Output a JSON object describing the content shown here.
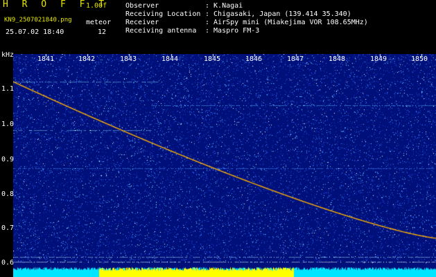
{
  "header": {
    "title": "H R O F F T",
    "version": "1.00f",
    "filename": "KN9_2507021840.png",
    "datetime": "25.07.02 18:40",
    "meteor_label": "meteor",
    "meteor_count": "12"
  },
  "info": {
    "observer_label": "Observer",
    "observer_value": ": K.Nagai",
    "location_label": "Receiving Location",
    "location_value": ": Chigasaki, Japan (139.414 35.340)",
    "receiver_label": "Receiver",
    "receiver_value": ": AirSpy mini (Miakejima VOR 108.65MHz)",
    "antenna_label": "Receiving antenna",
    "antenna_value": ": Maspro FM-3"
  },
  "axes": {
    "y_unit": "kHz",
    "y_ticks": [
      "1.1",
      "1.0",
      "0.9",
      "0.8",
      "0.7",
      "0.6"
    ],
    "x_ticks": [
      "1841",
      "1842",
      "1843",
      "1844",
      "1845",
      "1846",
      "1847",
      "1848",
      "1849",
      "1850"
    ]
  },
  "colors": {
    "background": "#000000",
    "waterfall": "#00107a",
    "header_accent": "#e6e600",
    "trace": "#ffb000",
    "level_bar": "#00e5ff",
    "level_peak": "#ffff00"
  }
}
